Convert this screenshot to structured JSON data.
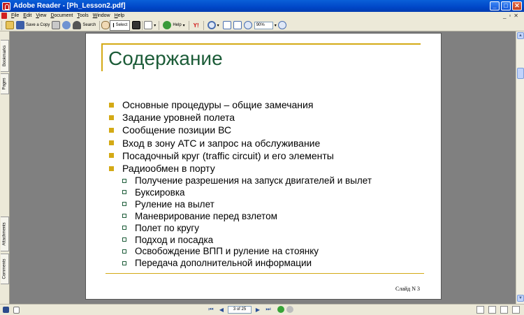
{
  "window": {
    "title": "Adobe Reader - [Ph_Lesson2.pdf]",
    "buttons": [
      "_",
      "□",
      "✕"
    ]
  },
  "menu": {
    "items": [
      "File",
      "Edit",
      "View",
      "Document",
      "Tools",
      "Window",
      "Help"
    ],
    "doc_controls": [
      "_",
      "▫",
      "✕"
    ]
  },
  "toolbar": {
    "save_copy": "Save a Copy",
    "search": "Search",
    "select": "Select",
    "help": "Help",
    "zoom": "90%",
    "tool_y": "Y!"
  },
  "sidebar": {
    "tabs": [
      "Bookmarks",
      "Pages",
      "Attachments",
      "Comments"
    ]
  },
  "slide": {
    "title": "Содержание",
    "items": [
      "Основные процедуры – общие замечания",
      "Задание уровней полета",
      "Сообщение позиции ВС",
      "Вход в зону АТС и запрос на обслуживание",
      "Посадочный круг (traffic circuit) и его элементы",
      "Радиообмен в порту"
    ],
    "subitems": [
      "Получение разрешения на запуск двигателей и вылет",
      "Буксировка",
      "Руление на вылет",
      "Маневрирование перед взлетом",
      "Полет по кругу",
      "Подход и посадка",
      "Освобождение ВПП и руление на стоянку",
      "Передача дополнительной информации"
    ],
    "slide_number": "Слайд N 3"
  },
  "statusbar": {
    "page_indicator": "3 of 25"
  },
  "colors": {
    "accent": "#d4aa15",
    "title_green": "#1c5c38",
    "titlebar_blue": "#0047c8"
  }
}
